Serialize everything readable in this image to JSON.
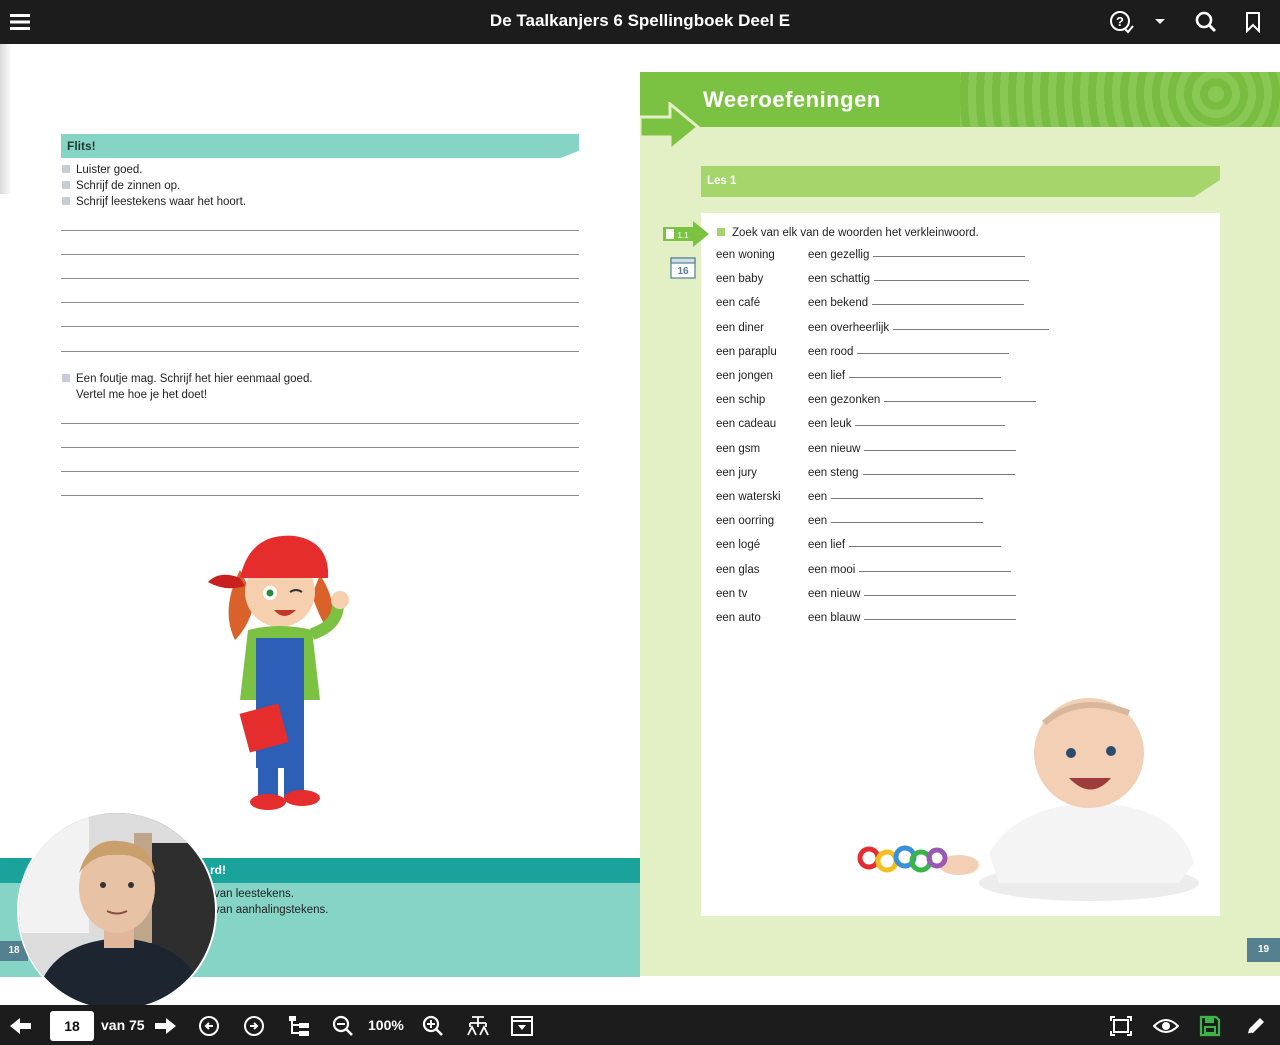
{
  "topbar": {
    "title": "De Taalkanjers 6 Spellingboek Deel E",
    "icons": [
      "menu-icon",
      "help-icon",
      "dropdown-icon",
      "search-icon",
      "bookmark-icon"
    ]
  },
  "left_page": {
    "flits_label": "Flits!",
    "instructions": [
      "Luister goed.",
      "Schrijf de zinnen op.",
      "Schrijf leestekens waar het hoort."
    ],
    "second_instruction_line1": "Een foutje mag. Schrijf het hier eenmaal goed.",
    "second_instruction_line2": "Vertel me hoe je het doet!",
    "bottom_banner_partial": "rd!",
    "bottom_line1": "van leestekens.",
    "bottom_line2": "van aanhalingstekens.",
    "page_number": "18"
  },
  "right_page": {
    "header_title": "Weeroefeningen",
    "lesson_label": "Les 1",
    "exercise_badge": "1.1",
    "calendar_badge": "16",
    "task": "Zoek van elk van de woorden het verkleinwoord.",
    "left_words": [
      "een woning",
      "een baby",
      "een café",
      "een diner",
      "een paraplu",
      "een jongen",
      "een schip",
      "een cadeau",
      "een gsm",
      "een jury",
      "een waterski",
      "een oorring",
      "een logé",
      "een glas",
      "een tv",
      "een auto"
    ],
    "right_words": [
      "een gezellig",
      "een schattig",
      "een bekend",
      "een overheerlijk",
      "een rood",
      "een lief",
      "een gezonken",
      "een leuk",
      "een nieuw",
      "een steng",
      "een",
      "een",
      "een lief",
      "een mooi",
      "een nieuw",
      "een blauw"
    ],
    "page_number": "19"
  },
  "bottombar": {
    "current_page": "18",
    "of_label": "van 75",
    "zoom": "100%"
  },
  "colors": {
    "bar_bg": "#1c1c1c",
    "teal": "#86d4c6",
    "teal_dark": "#1aa39b",
    "green": "#7cc242",
    "light_green": "#e3f0c6",
    "save_green": "#3ab54a"
  }
}
